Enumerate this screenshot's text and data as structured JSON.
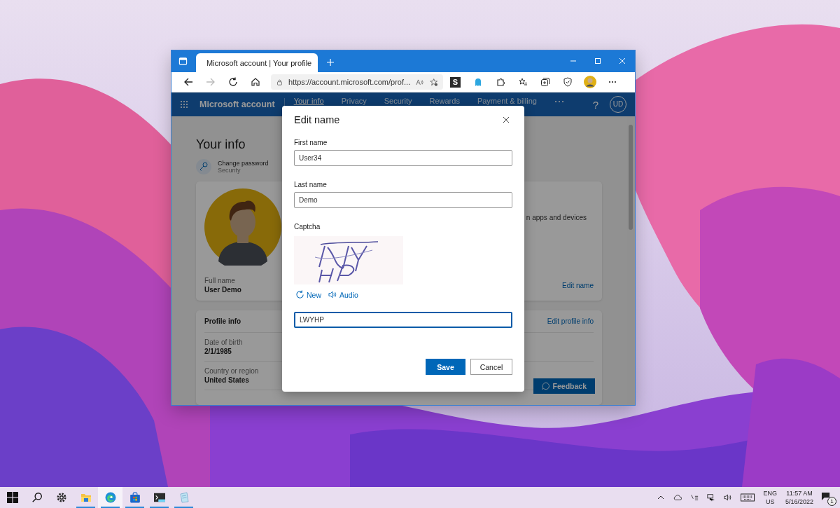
{
  "browser": {
    "tab": {
      "title": "Microsoft account | Your profile",
      "selected": true
    },
    "address": "https://account.microsoft.com/prof...",
    "extension_label": "S"
  },
  "site_nav": {
    "brand": "Microsoft account",
    "items": [
      {
        "label": "Your info",
        "selected": true
      },
      {
        "label": "Privacy",
        "selected": false
      },
      {
        "label": "Security",
        "selected": false
      },
      {
        "label": "Rewards",
        "selected": false
      },
      {
        "label": "Payment & billing",
        "selected": false
      }
    ],
    "help": "?",
    "initials": "UD"
  },
  "page": {
    "heading": "Your info",
    "password_link": {
      "title": "Change password",
      "subtitle": "Security"
    },
    "profile_card": {
      "full_name_label": "Full name",
      "full_name": "User Demo",
      "side_text": "n apps and devices",
      "edit_link": "Edit name"
    },
    "profile_info": {
      "title": "Profile info",
      "edit_link": "Edit profile info",
      "fields": [
        {
          "label": "Date of birth",
          "value": "2/1/1985"
        },
        {
          "label": "Country or region",
          "value": "United States"
        }
      ]
    },
    "feedback": "Feedback"
  },
  "dialog": {
    "title": "Edit name",
    "fields": [
      {
        "label": "First name",
        "value": "User34",
        "focused": false
      },
      {
        "label": "Last name",
        "value": "Demo",
        "focused": false
      }
    ],
    "captcha": {
      "label": "Captcha",
      "links": [
        {
          "kind": "refresh",
          "label": "New"
        },
        {
          "kind": "audio",
          "label": "Audio"
        }
      ],
      "value": "LWYHP",
      "focused": true
    },
    "buttons": [
      {
        "label": "Save",
        "kind": "primary"
      },
      {
        "label": "Cancel",
        "kind": "secondary"
      }
    ]
  },
  "taskbar": {
    "apps": [
      {
        "kind": "start",
        "running": false,
        "selected": false
      },
      {
        "kind": "search",
        "running": false,
        "selected": false
      },
      {
        "kind": "settings",
        "running": false,
        "selected": false
      },
      {
        "kind": "explorer",
        "running": true,
        "selected": false
      },
      {
        "kind": "edge",
        "running": true,
        "selected": true
      },
      {
        "kind": "store",
        "running": true,
        "selected": false
      },
      {
        "kind": "terminal",
        "running": true,
        "selected": false
      },
      {
        "kind": "notepad",
        "running": true,
        "selected": false
      }
    ],
    "language": "ENG",
    "region": "US",
    "time": "11:57 AM",
    "date": "5/16/2022",
    "notifications": "1"
  }
}
